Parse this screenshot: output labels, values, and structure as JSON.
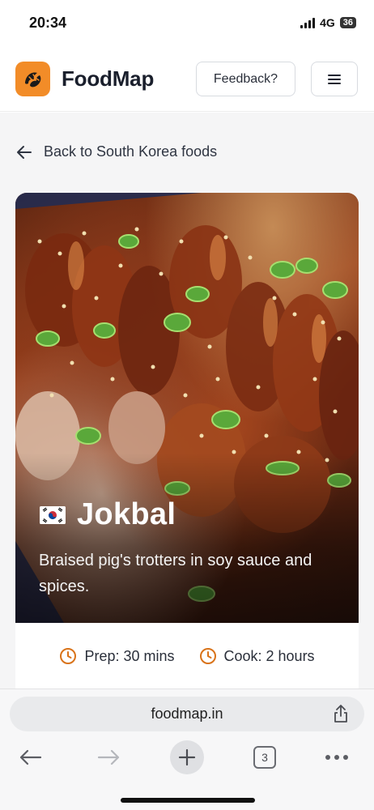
{
  "status_bar": {
    "time": "20:34",
    "network": "4G",
    "battery": "36"
  },
  "header": {
    "brand": "FoodMap",
    "logo_icon": "croissant-icon",
    "feedback_label": "Feedback?",
    "menu_icon": "hamburger-menu-icon",
    "accent_color": "#f28c28"
  },
  "nav": {
    "back_label": "Back to South Korea foods",
    "back_icon": "arrow-left-icon"
  },
  "food": {
    "flag": "south-korea-flag-icon",
    "name": "Jokbal",
    "description": "Braised pig's trotters in soy sauce and spices.",
    "prep": "Prep: 30 mins",
    "cook": "Cook: 2 hours",
    "clock_color": "#d9731a"
  },
  "browser": {
    "url": "foodmap.in",
    "tab_count": "3",
    "share_icon": "share-icon",
    "back_icon": "browser-back-icon",
    "forward_icon": "browser-forward-icon",
    "new_tab_icon": "plus-icon",
    "more_icon": "more-dots-icon"
  }
}
